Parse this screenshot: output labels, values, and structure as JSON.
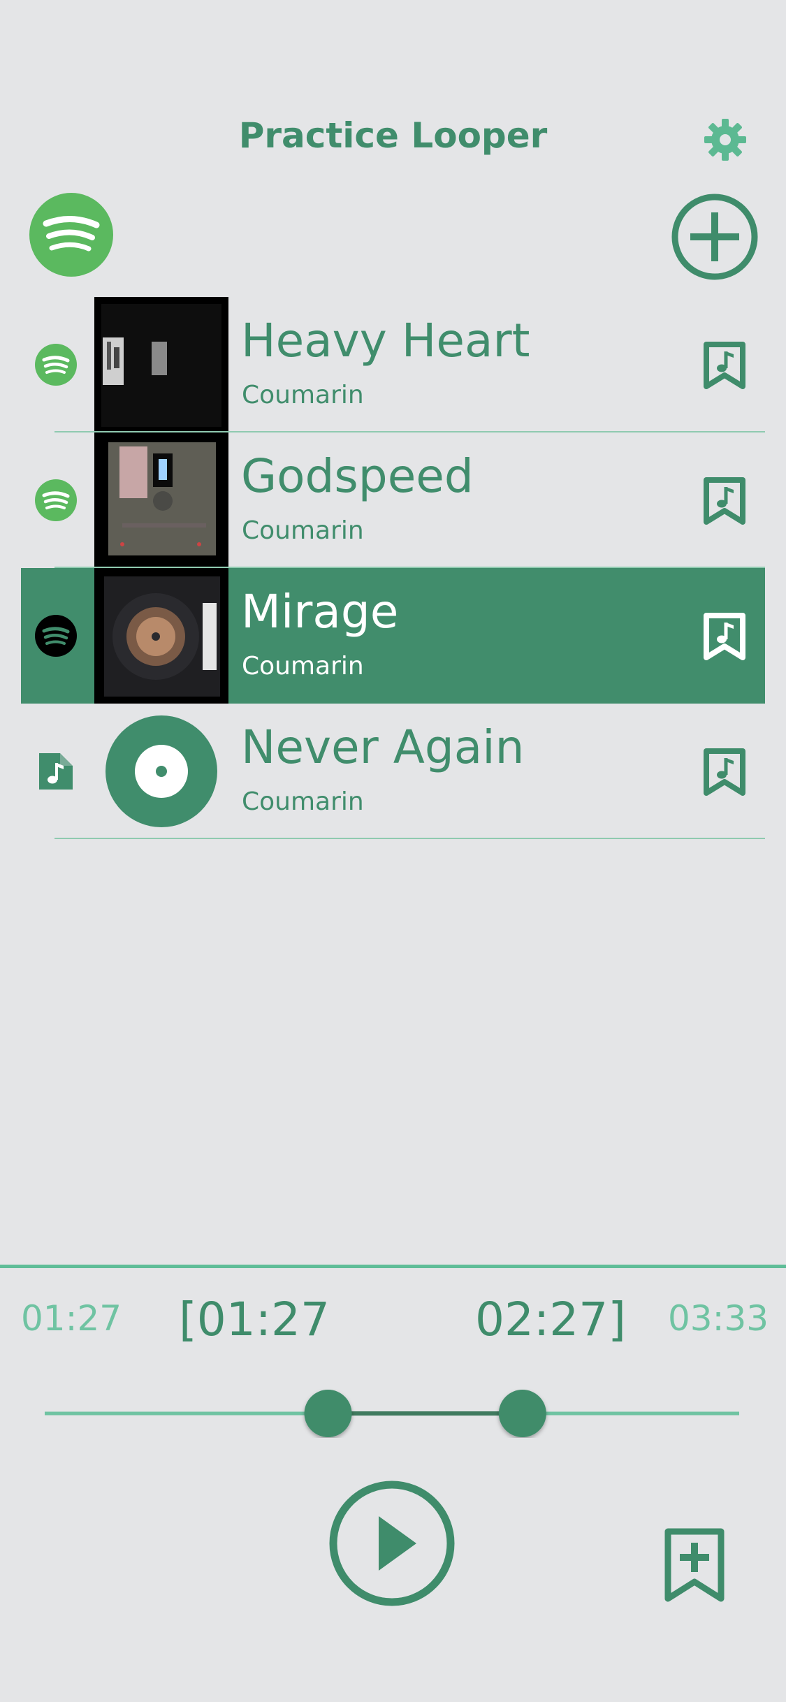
{
  "header": {
    "title": "Practice Looper"
  },
  "toolbar": {
    "settings_icon": "gear-icon",
    "spotify_icon": "spotify-icon",
    "add_icon": "plus-circle-icon"
  },
  "songs": [
    {
      "title": "Heavy Heart",
      "artist": "Coumarin",
      "source": "spotify",
      "selected": false
    },
    {
      "title": "Godspeed",
      "artist": "Coumarin",
      "source": "spotify",
      "selected": false
    },
    {
      "title": "Mirage",
      "artist": "Coumarin",
      "source": "spotify",
      "selected": true
    },
    {
      "title": "Never Again",
      "artist": "Coumarin",
      "source": "local-file",
      "selected": false
    }
  ],
  "player": {
    "current_time": "01:27",
    "loop_start": "[01:27",
    "loop_end": "02:27]",
    "total_time": "03:33",
    "loop_start_fraction": 0.408,
    "loop_end_fraction": 0.688
  },
  "colors": {
    "accent": "#408d6c",
    "accent_light": "#5fbd98",
    "spotify_green": "#5bb95f",
    "background": "#e4e5e7"
  }
}
